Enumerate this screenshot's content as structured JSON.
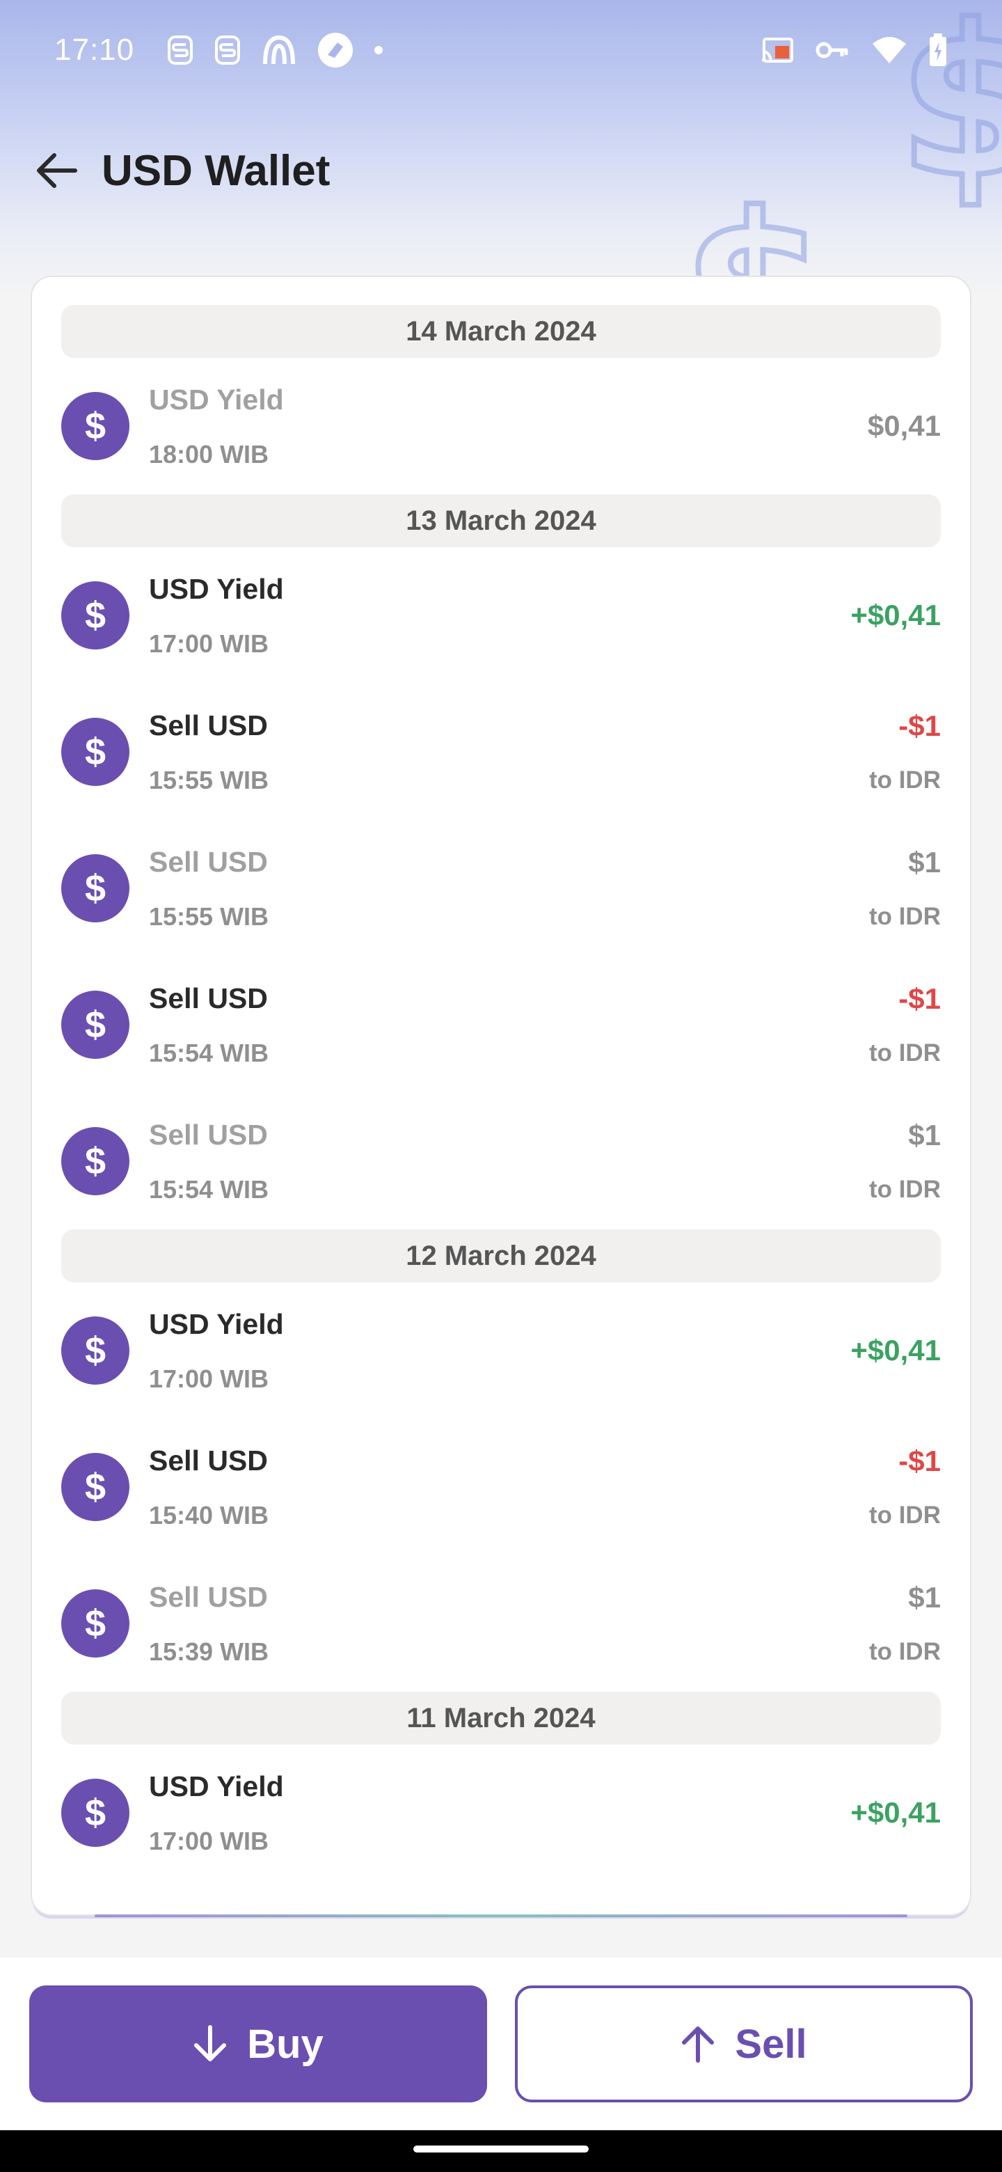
{
  "status_bar": {
    "time": "17:10"
  },
  "header": {
    "title": "USD Wallet"
  },
  "groups": [
    {
      "date": "14 March 2024",
      "items": [
        {
          "title": "USD Yield",
          "time": "18:00 WIB",
          "amount": "$0,41",
          "sub": "",
          "tone": "grey",
          "muted": true
        }
      ]
    },
    {
      "date": "13 March 2024",
      "items": [
        {
          "title": "USD Yield",
          "time": "17:00 WIB",
          "amount": "+$0,41",
          "sub": "",
          "tone": "green",
          "muted": false
        },
        {
          "title": "Sell USD",
          "time": "15:55 WIB",
          "amount": "-$1",
          "sub": "to IDR",
          "tone": "red",
          "muted": false
        },
        {
          "title": "Sell USD",
          "time": "15:55 WIB",
          "amount": "$1",
          "sub": "to IDR",
          "tone": "grey",
          "muted": true
        },
        {
          "title": "Sell USD",
          "time": "15:54 WIB",
          "amount": "-$1",
          "sub": "to IDR",
          "tone": "red",
          "muted": false
        },
        {
          "title": "Sell USD",
          "time": "15:54 WIB",
          "amount": "$1",
          "sub": "to IDR",
          "tone": "grey",
          "muted": true
        }
      ]
    },
    {
      "date": "12 March 2024",
      "items": [
        {
          "title": "USD Yield",
          "time": "17:00 WIB",
          "amount": "+$0,41",
          "sub": "",
          "tone": "green",
          "muted": false
        },
        {
          "title": "Sell USD",
          "time": "15:40 WIB",
          "amount": "-$1",
          "sub": "to IDR",
          "tone": "red",
          "muted": false
        },
        {
          "title": "Sell USD",
          "time": "15:39 WIB",
          "amount": "$1",
          "sub": "to IDR",
          "tone": "grey",
          "muted": true
        }
      ]
    },
    {
      "date": "11 March 2024",
      "items": [
        {
          "title": "USD Yield",
          "time": "17:00 WIB",
          "amount": "+$0,41",
          "sub": "",
          "tone": "green",
          "muted": false
        }
      ]
    }
  ],
  "icons": {
    "transaction": "dollar-icon",
    "tx_symbol": "$"
  },
  "actions": {
    "buy_label": "Buy",
    "sell_label": "Sell"
  },
  "colors": {
    "primary": "#6a4fb0",
    "positive": "#3ba262",
    "negative": "#e04646",
    "muted": "#8f8f8f"
  }
}
